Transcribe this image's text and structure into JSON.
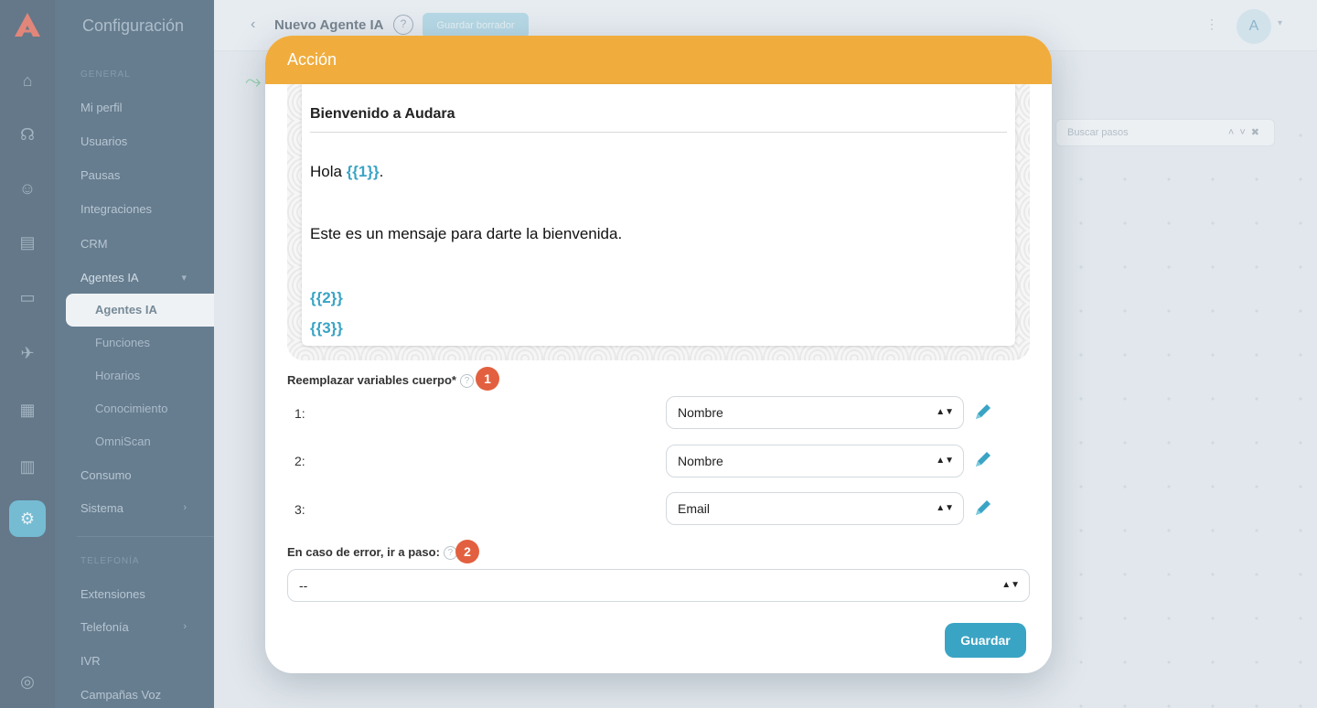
{
  "app": {
    "settings_title": "Configuración",
    "sidebar": {
      "section_general": "GENERAL",
      "items": [
        "Mi perfil",
        "Usuarios",
        "Pausas",
        "Integraciones",
        "CRM",
        "Agentes IA"
      ],
      "sub_items": [
        "Agentes IA",
        "Funciones",
        "Horarios",
        "Conocimiento",
        "OmniScan"
      ],
      "items_after": [
        "Consumo",
        "Sistema"
      ],
      "section_telephony": "TELEFONÍA",
      "items_bottom": [
        "Extensiones",
        "Telefonía",
        "IVR",
        "Campañas Voz"
      ]
    },
    "page_title": "Nuevo Agente IA",
    "help_icon_glyph": "?",
    "keep_button": "Guardar borrador",
    "avatar_initial": "A",
    "search_placeholder": "Buscar pasos"
  },
  "modal": {
    "title": "Acción",
    "header_color": "#f0ad3e",
    "preview": {
      "title": "Bienvenido a Audara",
      "line1_prefix": "Hola ",
      "line1_var": "{{1}}",
      "line1_suffix": ".",
      "line2": "Este es un mensaje para darte la bienvenida.",
      "var2": "{{2}}",
      "var3": "{{3}}"
    },
    "replace_label": "Reemplazar variables cuerpo*",
    "replace_marker": "1",
    "variables": [
      {
        "num": "1:",
        "value": "Nombre"
      },
      {
        "num": "2:",
        "value": "Nombre"
      },
      {
        "num": "3:",
        "value": "Email"
      }
    ],
    "error_label": "En caso de error, ir a paso:",
    "error_marker": "2",
    "error_select_value": "--",
    "save_label": "Guardar",
    "accent_color": "#3aa4c4",
    "marker_color": "#e2603f"
  }
}
